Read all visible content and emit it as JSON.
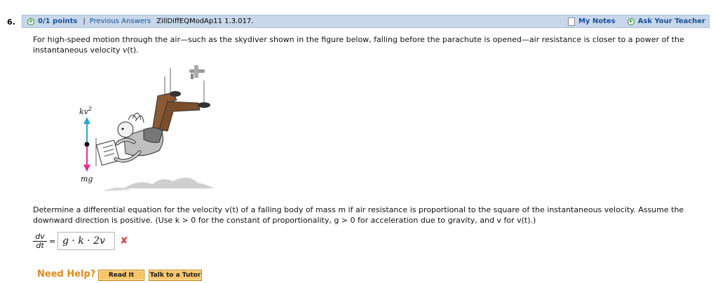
{
  "question": {
    "number": "6.",
    "points": "0/1 points",
    "separator": "|",
    "previous_answers": "Previous Answers",
    "id": "ZillDiffEQModAp11 1.3.017.",
    "my_notes": "My Notes",
    "ask_teacher": "Ask Your Teacher",
    "intro_before": "For high-speed motion through the air—such as the skydiver shown in the figure below, falling before the parachute is opened—air resistance is closer to a power of the instantaneous velocity ",
    "intro_var": "v",
    "intro_after": "(t).",
    "figure": {
      "label_top": "kv",
      "label_top_exp": "2",
      "label_bottom": "mg",
      "up_arrow_color": "#2aa6d8",
      "down_arrow_color": "#e0308a"
    },
    "determine_text": "Determine a differential equation for the velocity v(t) of a falling body of mass m if air resistance is proportional to the square of the instantaneous velocity. Assume the downward direction is positive. (Use k > 0 for the constant of proportionality, g > 0 for acceleration due to gravity, and v for v(t).)",
    "derivative_num": "dv",
    "derivative_den": "dt",
    "equals": "=",
    "answer_value": "g · k · 2v",
    "answer_status": "incorrect",
    "answer_mark": "✘",
    "need_help": "Need Help?",
    "read_it": "Read It",
    "talk_to_tutor": "Talk to a Tutor"
  },
  "colors": {
    "header_bg": "#c8d8ea",
    "link": "#1a4e9a",
    "help_orange": "#e08a1a",
    "button_bg": "#f7c66a",
    "wrong_red": "#e23b3b"
  }
}
